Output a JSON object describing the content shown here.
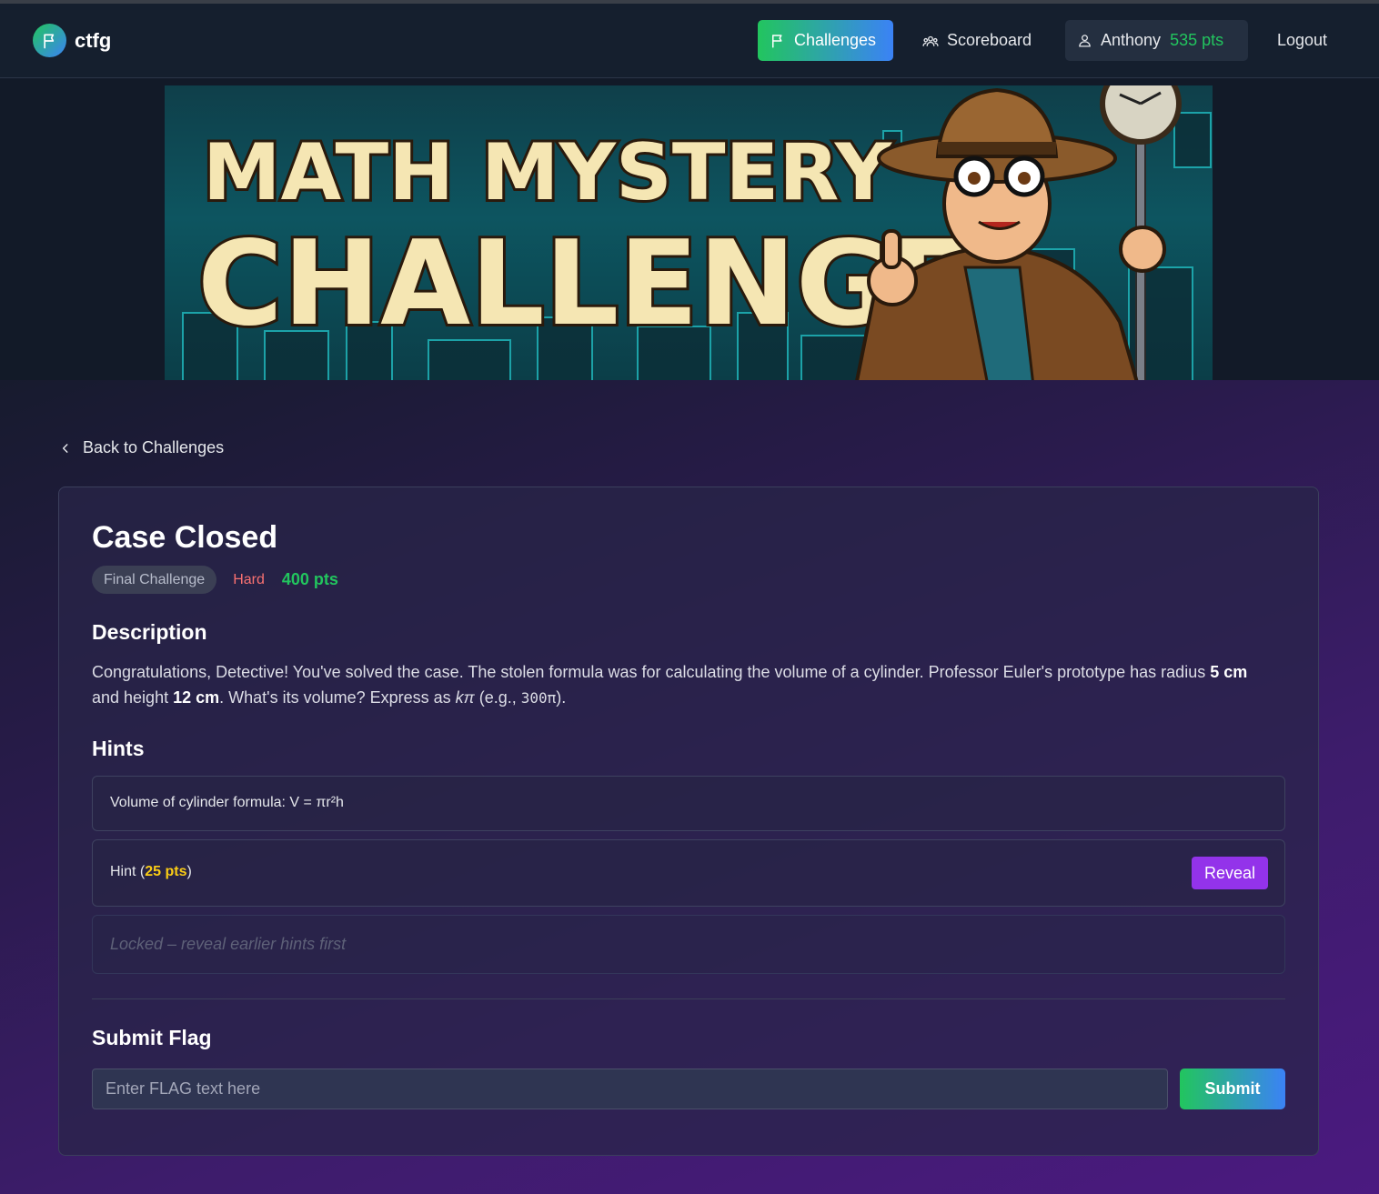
{
  "brand": {
    "name": "ctfg",
    "icon": "flag-icon"
  },
  "nav": {
    "challenges": "Challenges",
    "scoreboard": "Scoreboard",
    "user_name": "Anthony",
    "user_points": "535 pts",
    "logout": "Logout"
  },
  "banner": {
    "line1": "MATH MYSTERY",
    "line2": "CHALLENGE",
    "illustration": "cartoon detective with magnifying glass giving thumbs up"
  },
  "back_link": "Back to Challenges",
  "challenge": {
    "title": "Case Closed",
    "category": "Final Challenge",
    "difficulty": "Hard",
    "points": "400 pts",
    "description_heading": "Description",
    "description": {
      "p1": "Congratulations, Detective! You've solved the case. The stolen formula was for calculating the volume of a cylinder. Professor Euler's prototype has radius ",
      "radius": "5 cm",
      "p2": " and height ",
      "height": "12 cm",
      "p3": ". What's its volume? Express as ",
      "expr": "kπ",
      "p4": " (e.g., ",
      "example": "300π",
      "p5": ")."
    }
  },
  "hints": {
    "heading": "Hints",
    "revealed": "Volume of cylinder formula: V = πr²h",
    "paid_label": "Hint (",
    "paid_cost": "25 pts",
    "paid_close": ")",
    "reveal_button": "Reveal",
    "locked": "Locked – reveal earlier hints first"
  },
  "submit": {
    "heading": "Submit Flag",
    "placeholder": "Enter FLAG text here",
    "button": "Submit"
  },
  "colors": {
    "accent_green": "#22c55e",
    "accent_blue": "#3b82f6",
    "purple": "#9333ea",
    "hard": "#f87171",
    "hint_cost": "#facc15"
  }
}
